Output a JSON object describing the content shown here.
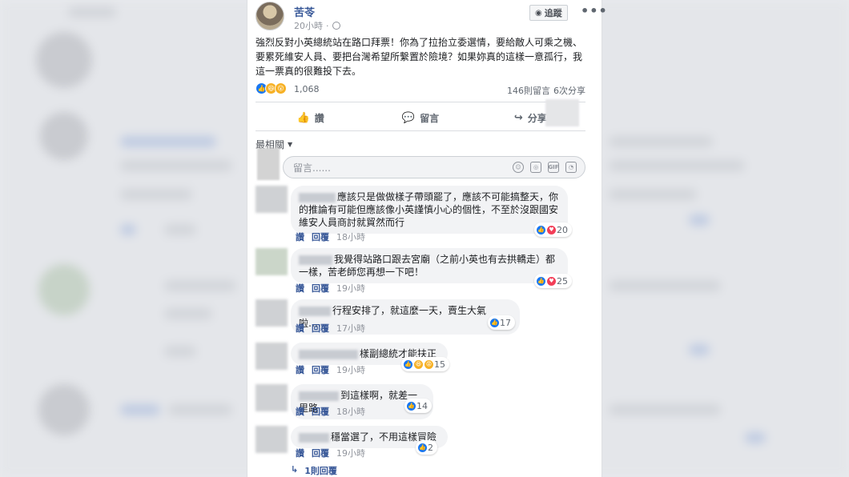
{
  "post": {
    "author": "苦苓",
    "time": "20小時",
    "follow_label": "追蹤",
    "more_label": "•••",
    "text": "強烈反對小英總統站在路口拜票！你為了拉抬立委選情，要給敵人可乘之機、要累死維安人員、要把台灣希望所繫置於險境？如果妳真的這樣一意孤行，我這一票真的很難投下去。",
    "reaction_count": "1,068",
    "comment_count": "146則留言",
    "share_count": "6次分享"
  },
  "actions": {
    "like": "讚",
    "comment": "留言",
    "share": "分享"
  },
  "sort_label": "最相關",
  "comment_input": {
    "placeholder": "留言......"
  },
  "comments": [
    {
      "text": "應該只是做做樣子帶頭罷了，應該不可能搞整天，你的推論有可能但應該像小英謹慎小心的個性，不至於沒跟國安維安人員商討就貿然而行",
      "count": "20",
      "like": "讚",
      "reply": "回覆",
      "time": "18小時"
    },
    {
      "text": "我覺得站路口跟去宮廟（之前小英也有去拱轎走）都一樣，苦老師您再想一下吧！",
      "count": "25",
      "like": "讚",
      "reply": "回覆",
      "time": "19小時"
    },
    {
      "text": "行程安排了，就這麼一天，賣生大氣啦……",
      "count": "17",
      "like": "讚",
      "reply": "回覆",
      "time": "17小時"
    },
    {
      "text": "樣副總統才能扶正",
      "count": "15",
      "like": "讚",
      "reply": "回覆",
      "time": "19小時"
    },
    {
      "text": "到這樣啊，就差一里路",
      "count": "14",
      "like": "讚",
      "reply": "回覆",
      "time": "18小時"
    },
    {
      "text": "穩當選了，不用這樣冒險",
      "count": "2",
      "like": "讚",
      "reply": "回覆",
      "time": "19小時"
    }
  ],
  "reply_link": "1則回覆",
  "colors": {
    "link": "#385898",
    "like": "#1877f2",
    "love": "#f33e58",
    "haha": "#f7b125"
  }
}
